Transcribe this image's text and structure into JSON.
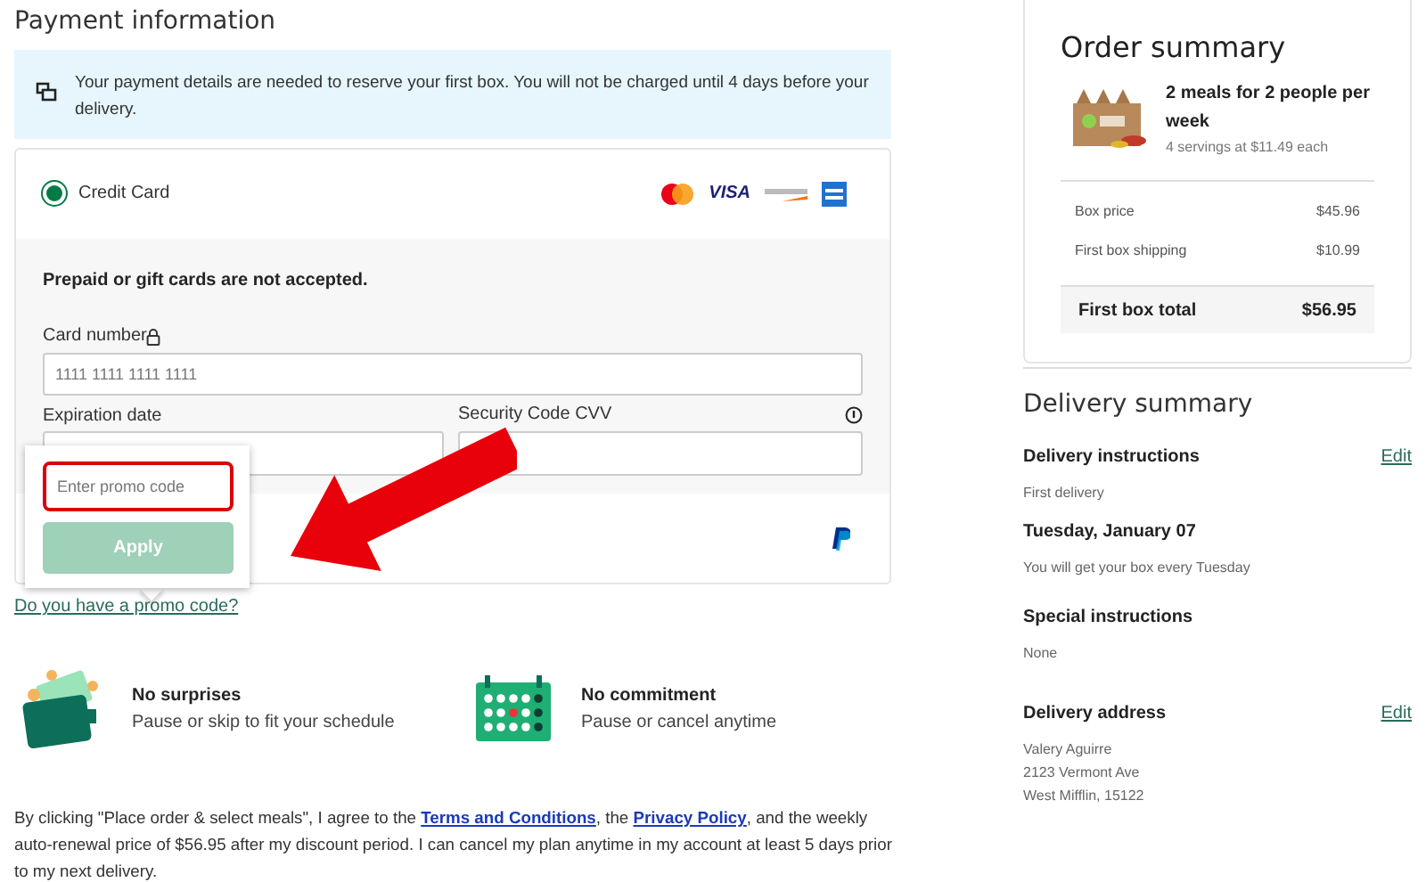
{
  "payment": {
    "title": "Payment information",
    "notice": "Your payment details are needed to reserve your first box. You will not be charged until 4 days before your delivery.",
    "credit_card": {
      "label": "Credit Card",
      "selected": true
    },
    "brands": [
      "VISA"
    ],
    "card_note": "Prepaid or gift cards are not accepted.",
    "card_number": {
      "label": "Card number",
      "placeholder": "1111 1111 1111 1111"
    },
    "expiration": {
      "label": "Expiration date"
    },
    "cvv": {
      "label": "Security Code CVV"
    },
    "promo": {
      "placeholder": "Enter promo code",
      "button": "Apply",
      "disabled": true
    },
    "promo_link": "Do you have a promo code?"
  },
  "features": [
    {
      "kind": "wallet",
      "title": "No surprises",
      "text": "Pause or skip to fit your schedule"
    },
    {
      "kind": "calendar",
      "title": "No commitment",
      "text": "Pause or cancel anytime"
    }
  ],
  "legal": [
    {
      "kind": "text",
      "text": "By clicking \"Place order & select meals\", I agree to the "
    },
    {
      "kind": "link",
      "text": "Terms and Conditions"
    },
    {
      "kind": "text",
      "text": ", the "
    },
    {
      "kind": "link",
      "text": "Privacy Policy"
    },
    {
      "kind": "text",
      "text": ", and the weekly auto-renewal price of $56.95 after my discount period. I can cancel my plan anytime in my account at least 5 days prior to my next delivery."
    }
  ],
  "order_summary": {
    "title": "Order summary",
    "plan": "2 meals for 2 people per week",
    "servings": "4 servings at $11.49 each",
    "lines": [
      {
        "label": "Box price",
        "value": "$45.96"
      },
      {
        "label": "First box shipping",
        "value": "$10.99"
      }
    ],
    "total": {
      "label": "First box total",
      "value": "$56.95"
    }
  },
  "delivery_summary": {
    "title": "Delivery summary",
    "sections": [
      {
        "heading": "Delivery instructions",
        "edit": "Edit",
        "lines": [
          "First delivery"
        ]
      },
      {
        "heading": "Tuesday, January 07",
        "lines": [
          "You will get your box every Tuesday"
        ]
      },
      {
        "heading": "Special instructions",
        "lines": [
          "None"
        ]
      },
      {
        "heading": "Delivery address",
        "edit": "Edit",
        "lines": [
          "Valery Aguirre",
          "2123 Vermont Ave",
          "West Mifflin, 15122"
        ]
      }
    ]
  }
}
